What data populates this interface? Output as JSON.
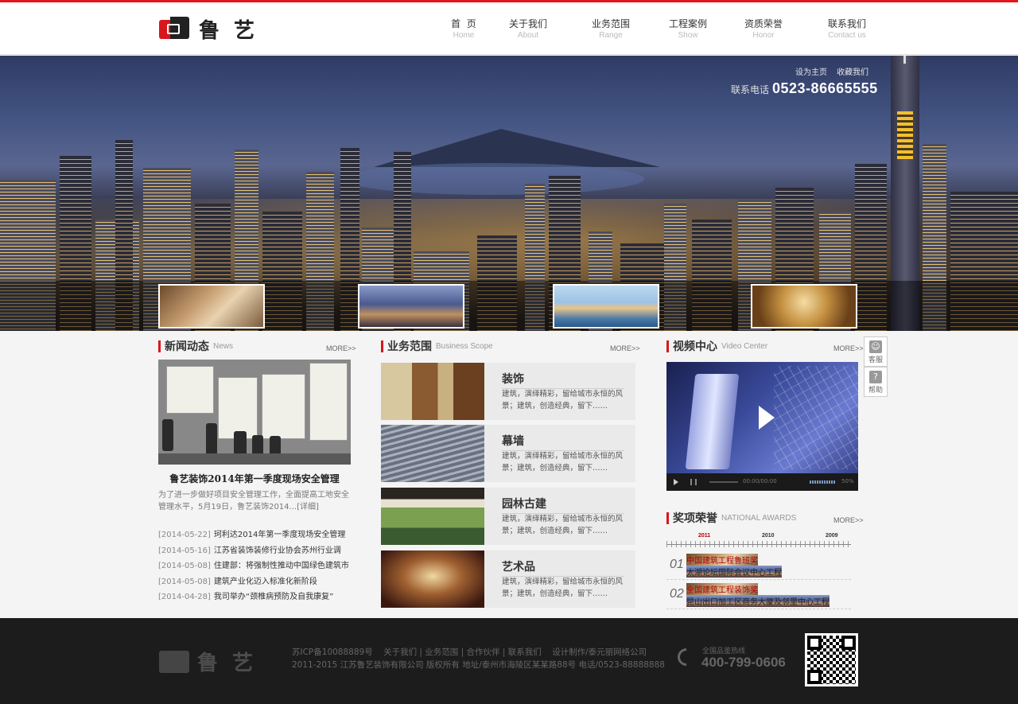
{
  "brand": {
    "chars": "鲁艺",
    "accent": "#e4161b"
  },
  "nav": [
    {
      "cn": "首  页",
      "en": "Home"
    },
    {
      "cn": "关于我们",
      "en": "About"
    },
    {
      "cn": "业务范围",
      "en": "Range"
    },
    {
      "cn": "工程案例",
      "en": "Show"
    },
    {
      "cn": "资质荣誉",
      "en": "Honor"
    },
    {
      "cn": "联系我们",
      "en": "Contact us"
    }
  ],
  "banner": {
    "set_home": "设为主页",
    "favorite": "收藏我们",
    "phone_label": "联系电话",
    "phone": "0523-86665555"
  },
  "news": {
    "title": "新闻动态",
    "en": "News",
    "more": "MORE>>",
    "headline": "鲁艺装饰2014年第一季度现场安全管理",
    "summary": "为了进一步做好项目安全管理工作，全面提高工地安全管理水平，5月19日，鲁艺装饰2014...[详细]",
    "items": [
      {
        "date": "[2014-05-22]",
        "text": "珂利达2014年第一季度现场安全管理"
      },
      {
        "date": "[2014-05-16]",
        "text": "江苏省装饰装修行业协会苏州行业调"
      },
      {
        "date": "[2014-05-08]",
        "text": "住建部：将强制性推动中国绿色建筑市"
      },
      {
        "date": "[2014-05-08]",
        "text": "建筑产业化迈入标准化新阶段"
      },
      {
        "date": "[2014-04-28]",
        "text": "我司举办“颈椎病预防及自我康复”"
      }
    ]
  },
  "business": {
    "title": "业务范围",
    "en": "Business Scope",
    "more": "MORE>>",
    "items": [
      {
        "title": "装饰",
        "desc": "建筑，演绎精彩，留给城市永恒的风景；建筑，创造经典，留下……"
      },
      {
        "title": "幕墙",
        "desc": "建筑，演绎精彩，留给城市永恒的风景；建筑，创造经典，留下……"
      },
      {
        "title": "园林古建",
        "desc": "建筑，演绎精彩，留给城市永恒的风景；建筑，创造经典，留下……"
      },
      {
        "title": "艺术品",
        "desc": "建筑，演绎精彩，留给城市永恒的风景；建筑，创造经典，留下……"
      }
    ]
  },
  "video": {
    "title": "视频中心",
    "en": "Video Center",
    "more": "MORE>>",
    "time": "00:00/00:00",
    "volume": "50%"
  },
  "side_tools": [
    {
      "label": "客服",
      "glyph": "☺"
    },
    {
      "label": "帮助",
      "glyph": "?"
    }
  ],
  "awards": {
    "title": "奖项荣誉",
    "en": "NATIONAL AWARDS",
    "more": "MORE>>",
    "years": [
      "2011",
      "2010",
      "2009"
    ],
    "items": [
      {
        "num": "01",
        "award": "中国建筑工程鲁班奖",
        "project": "太湖论坛国际会议中心工程"
      },
      {
        "num": "02",
        "award": "全国建筑工程装饰奖",
        "project": "昆山出口加工区商务大厦及邻里中心工程"
      }
    ]
  },
  "footer": {
    "icp": "苏ICP备10088889号",
    "links": [
      "关于我们",
      "业务范围",
      "合作伙伴",
      "联系我们"
    ],
    "design": "设计制作/泰元丽网络公司",
    "copyright": "2011-2015 江苏鲁艺装饰有限公司 版权所有  地址/泰州市海陵区某某路88号 电话/0523-88888888",
    "hotline_label": "全国品鉴热线",
    "hotline": "400-799-0606"
  }
}
